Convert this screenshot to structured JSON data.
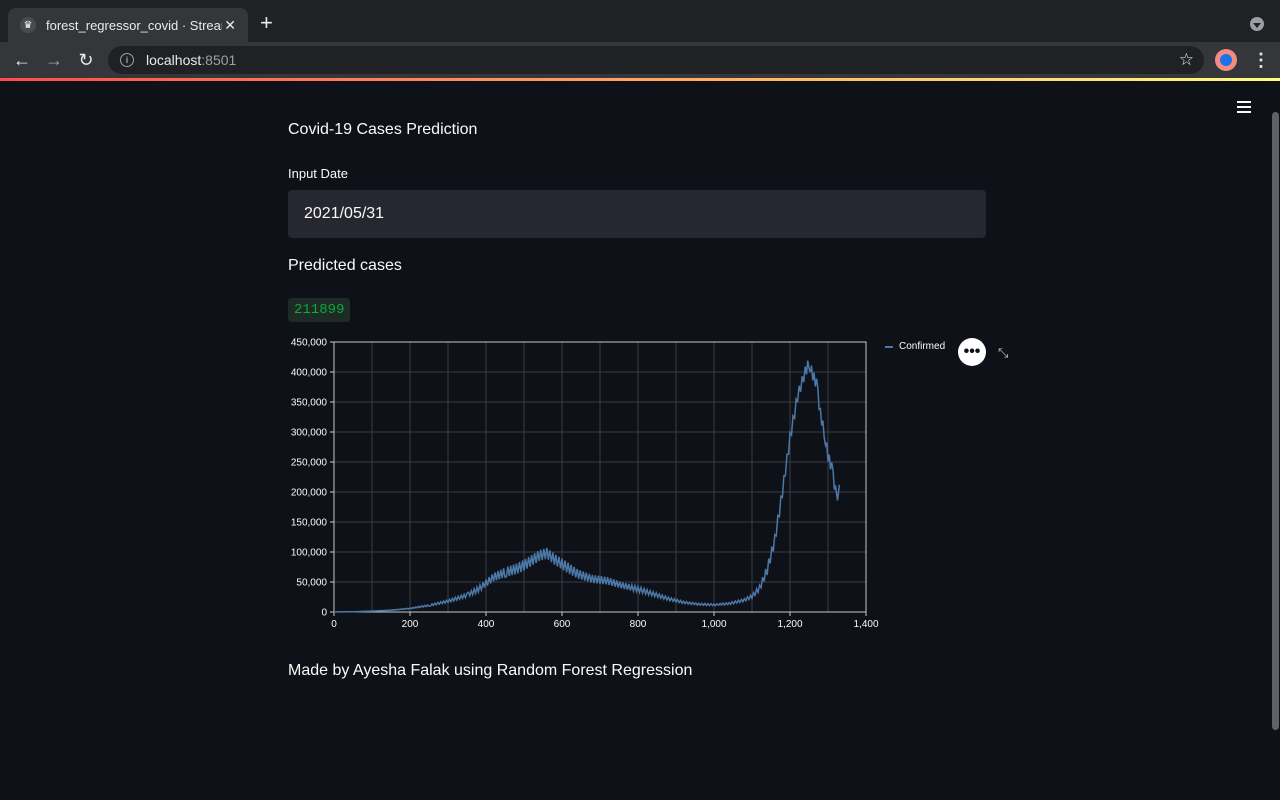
{
  "browser": {
    "tab_title": "forest_regressor_covid · Streamlit",
    "url_host": "localhost",
    "url_port": ":8501"
  },
  "app": {
    "title": "Covid-19 Cases Prediction",
    "input_label": "Input Date",
    "input_value": "2021/05/31",
    "prediction_title": "Predicted cases",
    "prediction_value": "211899",
    "footer": "Made by Ayesha Falak using Random Forest Regression"
  },
  "colors": {
    "accent": "#ff4b4b",
    "success": "#09ab3b",
    "series": "#4c78a8"
  },
  "chart_data": {
    "type": "line",
    "xlim": [
      0,
      1400
    ],
    "ylim": [
      0,
      450000
    ],
    "x_ticks": [
      "0",
      "200",
      "400",
      "600",
      "800",
      "1,000",
      "1,200",
      "1,400"
    ],
    "y_ticks": [
      "0",
      "50,000",
      "100,000",
      "150,000",
      "200,000",
      "250,000",
      "300,000",
      "350,000",
      "400,000",
      "450,000"
    ],
    "grid": true,
    "legend_position": "top-right",
    "series": [
      {
        "name": "Confirmed",
        "x": [
          0,
          50,
          100,
          150,
          200,
          250,
          300,
          350,
          380,
          400,
          420,
          450,
          480,
          500,
          520,
          540,
          560,
          580,
          600,
          640,
          680,
          720,
          760,
          800,
          840,
          880,
          920,
          960,
          1000,
          1040,
          1080,
          1100,
          1120,
          1140,
          1160,
          1180,
          1200,
          1220,
          1240,
          1250,
          1260,
          1270,
          1280,
          1290,
          1300,
          1310,
          1320,
          1325,
          1330
        ],
        "y": [
          0,
          500,
          1500,
          3000,
          6000,
          11000,
          18000,
          28000,
          38000,
          48000,
          58000,
          66000,
          72000,
          78000,
          86000,
          94000,
          98000,
          88000,
          80000,
          64000,
          55000,
          52000,
          44000,
          38000,
          30000,
          22000,
          16000,
          13000,
          12000,
          14000,
          20000,
          26000,
          40000,
          70000,
          120000,
          200000,
          290000,
          360000,
          400000,
          415000,
          395000,
          380000,
          330000,
          300000,
          260000,
          240000,
          200000,
          195000,
          211899
        ]
      }
    ]
  }
}
